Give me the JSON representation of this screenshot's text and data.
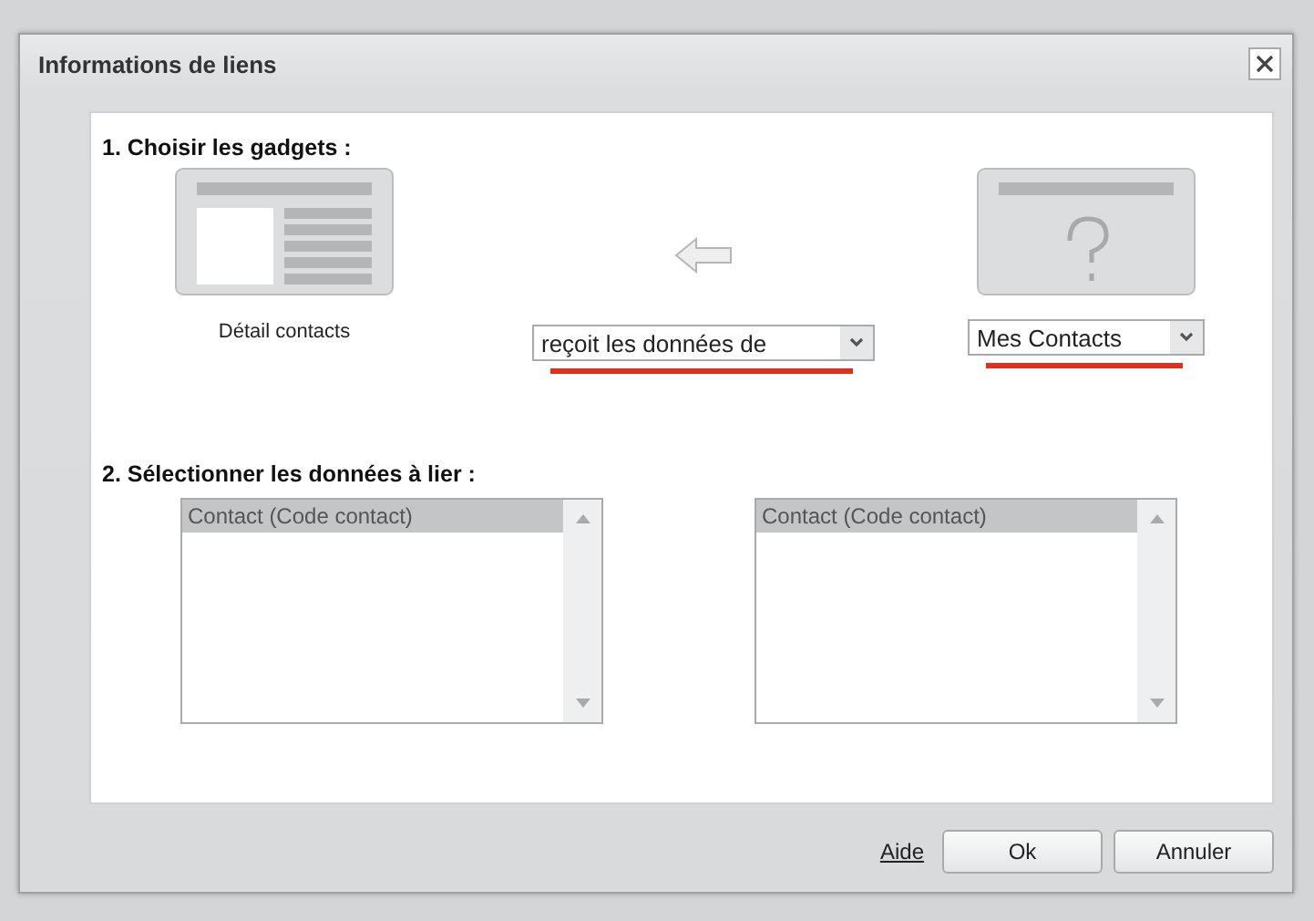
{
  "window": {
    "title": "Informations de liens"
  },
  "step1": {
    "heading": "1. Choisir les gadgets :",
    "source_gadget": {
      "kind": "detail",
      "label": "Détail contacts"
    },
    "relation": {
      "value": "reçoit les données de",
      "highlighted": true
    },
    "target_gadget": {
      "kind": "unknown"
    },
    "target_select": {
      "value": "Mes Contacts",
      "highlighted": true
    }
  },
  "step2": {
    "heading": "2. Sélectionner les données à lier :",
    "lists": [
      {
        "items": [
          {
            "label": "Contact (Code contact)",
            "selected": true
          }
        ]
      },
      {
        "items": [
          {
            "label": "Contact (Code contact)",
            "selected": true
          }
        ]
      }
    ]
  },
  "buttons": [
    {
      "label": "Aide",
      "kind": "link"
    },
    {
      "label": "Ok",
      "kind": "button"
    },
    {
      "label": "Annuler",
      "kind": "button"
    }
  ]
}
